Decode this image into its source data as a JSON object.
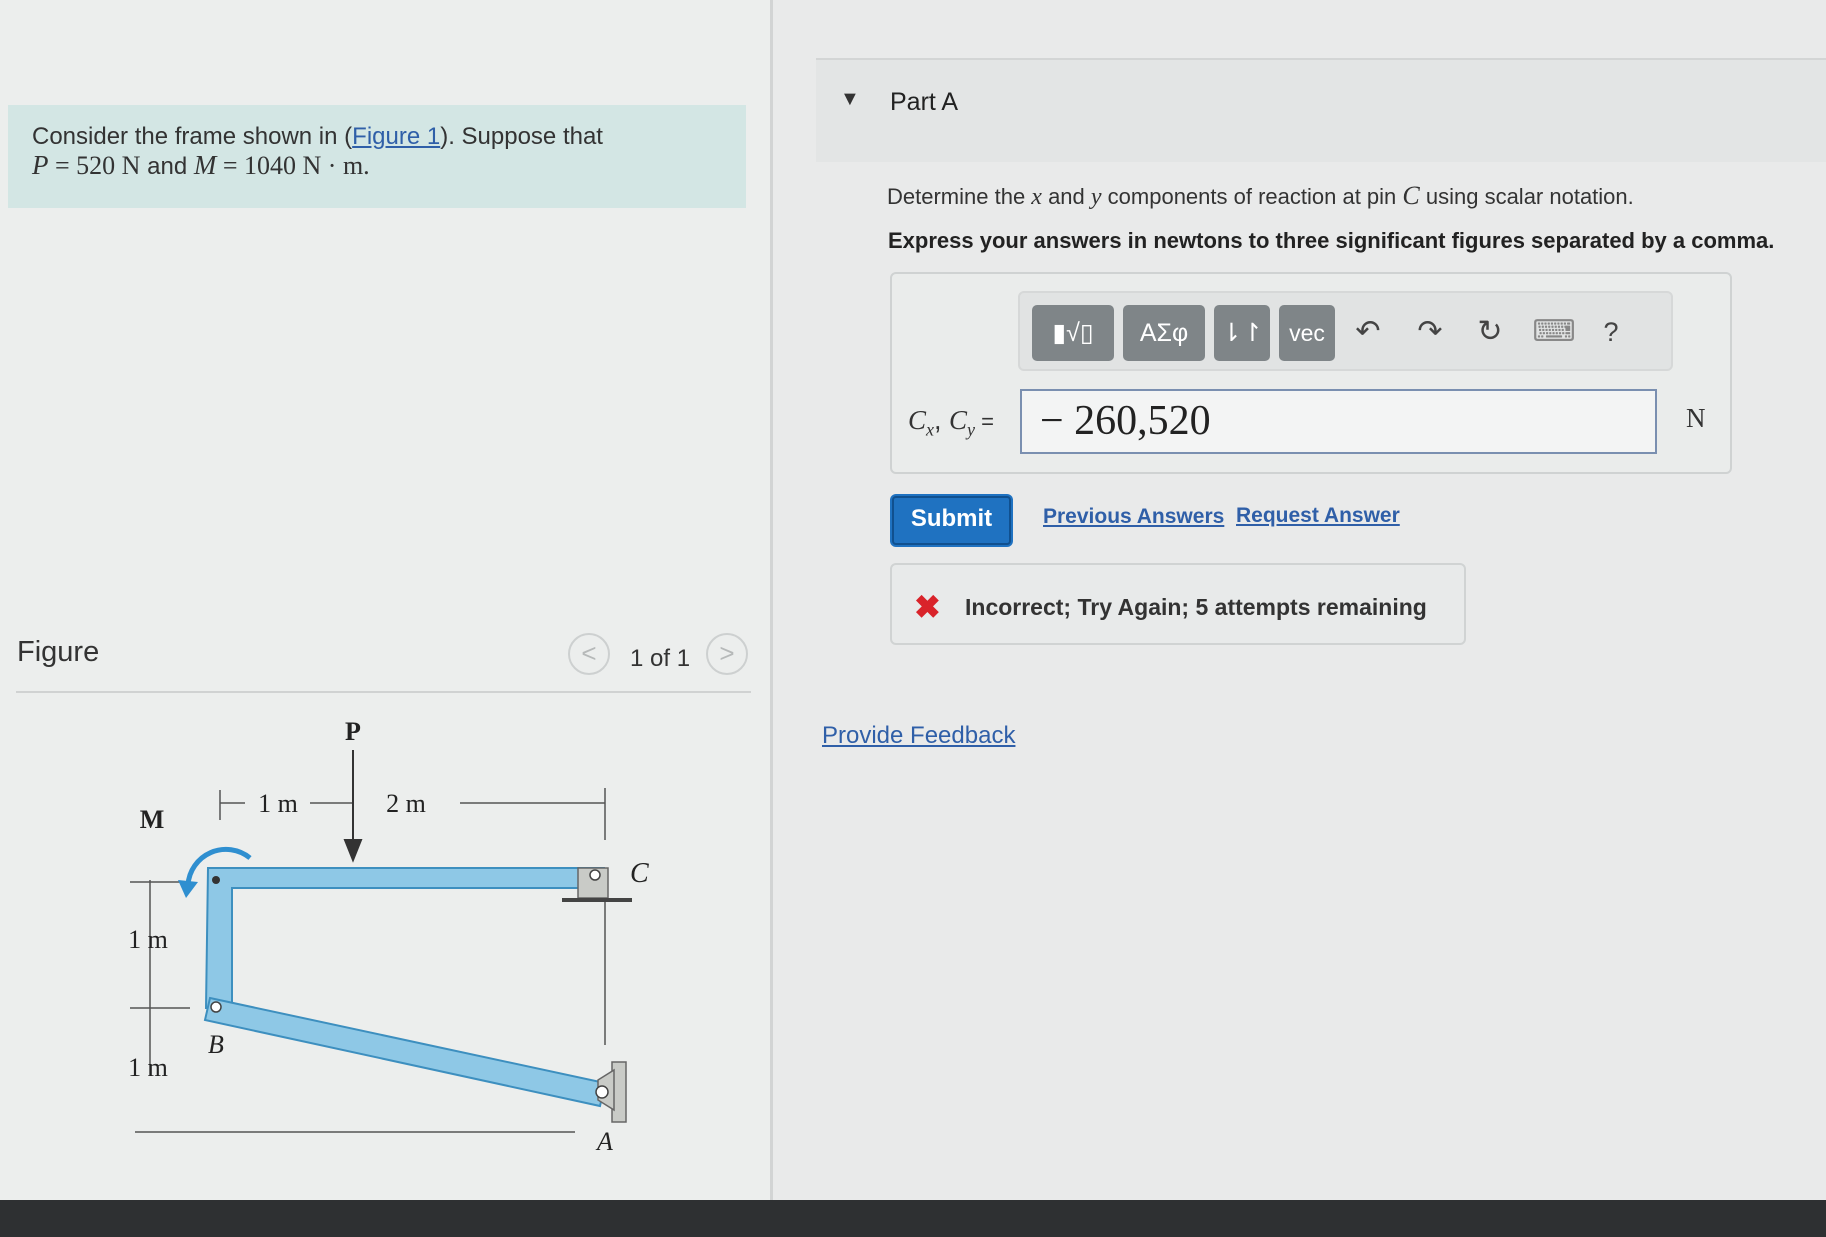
{
  "problem": {
    "prefix": "Consider the frame shown in (",
    "figure_link": "Figure 1",
    "suffix": "). Suppose that",
    "line2": {
      "p_var": "P",
      "p_value": " = 520 N",
      "and": " and ",
      "m_var": "M",
      "m_value": " = 1040 N · m."
    }
  },
  "figure": {
    "label": "Figure",
    "counter": "1 of 1",
    "prev_glyph": "<",
    "next_glyph": ">",
    "labels": {
      "P": "P",
      "M": "M",
      "C": "C",
      "B": "B",
      "A": "A",
      "dim_1m_top": "1 m",
      "dim_2m_top": "2 m",
      "dim_1m_upper": "1 m",
      "dim_1m_lower": "1 m"
    },
    "colors": {
      "member": "#8ec8e6",
      "member_edge": "#3d8fbf",
      "moment": "#2f8fd0"
    }
  },
  "part": {
    "toggle_icon": "▼",
    "title": "Part A",
    "question": {
      "pre": "Determine the ",
      "x": "x",
      "mid1": " and ",
      "y": "y",
      "mid2": " components of reaction at pin ",
      "c": "C",
      "post": " using scalar notation."
    },
    "instruction": "Express your answers in newtons to three significant figures separated by a comma."
  },
  "toolbar": {
    "templates_icon": "▮√▯",
    "greek": "ΑΣφ",
    "arrows": "⇂↾",
    "vec": "vec",
    "undo_icon": "↶",
    "redo_icon": "↷",
    "reset_icon": "↻",
    "keyboard_icon": "⌨",
    "help": "?"
  },
  "answer": {
    "label": "Cx, Cy =",
    "label_c1": "C",
    "label_x": "x",
    "label_sep": ", ",
    "label_c2": "C",
    "label_y": "y",
    "label_eq": " =",
    "value": "− 260,520",
    "unit": "N"
  },
  "actions": {
    "submit": "Submit",
    "previous_answers": "Previous Answers",
    "request_answer": "Request Answer"
  },
  "feedback": {
    "icon": "✖",
    "message": "Incorrect; Try Again; 5 attempts remaining"
  },
  "provide_feedback": "Provide Feedback",
  "colors": {
    "accent": "#1f72c1",
    "link": "#2f5fa8",
    "error": "#d9232a",
    "problem_bg": "#d3e6e4"
  }
}
